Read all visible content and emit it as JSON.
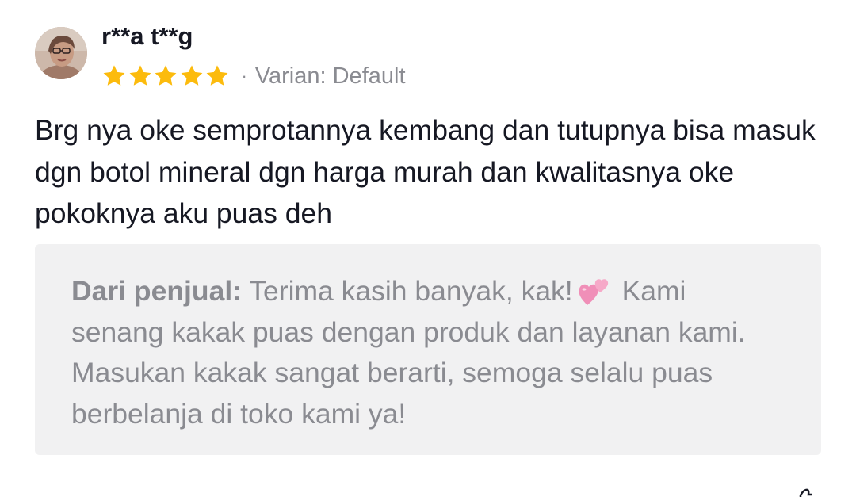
{
  "review": {
    "username": "r**a t**g",
    "rating": 5,
    "rating_max": 5,
    "star_color": "#fcbb0d",
    "separator": "·",
    "variant": "Varian: Default",
    "body": "Brg nya oke semprotannya kembang dan tutupnya bisa masuk dgn botol mineral dgn harga murah dan kwalitasnya oke pokoknya aku puas deh"
  },
  "seller_reply": {
    "label": "Dari penjual:",
    "text_before_emoji": "Terima kasih banyak, kak!",
    "emoji": "two-hearts-icon",
    "text_after_emoji": "Kami senang kakak puas dengan produk dan layanan kami. Masukan kakak sangat berarti, semoga selalu puas berbelanja di toko kami ya!"
  },
  "colors": {
    "text_primary": "#161823",
    "text_secondary": "#8a8b91",
    "reply_background": "#f1f1f2"
  }
}
